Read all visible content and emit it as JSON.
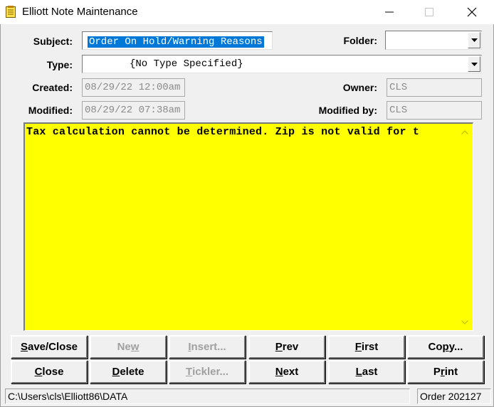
{
  "window": {
    "title": "Elliott Note Maintenance",
    "icon": "note-icon",
    "controls": [
      "minimize-icon",
      "maximize-icon",
      "close-icon"
    ]
  },
  "form": {
    "subject_label": "Subject:",
    "subject_value": "Order On Hold/Warning Reasons",
    "folder_label": "Folder:",
    "folder_value": "",
    "type_label": "Type:",
    "type_value": "{No Type Specified}",
    "created_label": "Created:",
    "created_value": "08/29/22 12:00am",
    "owner_label": "Owner:",
    "owner_value": "CLS",
    "modified_label": "Modified:",
    "modified_value": "08/29/22 07:38am",
    "modified_by_label": "Modified by:",
    "modified_by_value": "CLS"
  },
  "note": {
    "text": "Tax calculation cannot be determined. Zip is not valid for t",
    "background": "#ffff00"
  },
  "buttons": {
    "row1": [
      {
        "pre": "",
        "u": "S",
        "post": "ave/Close",
        "enabled": true
      },
      {
        "pre": "Ne",
        "u": "w",
        "post": "",
        "enabled": false
      },
      {
        "pre": "",
        "u": "I",
        "post": "nsert...",
        "enabled": false
      },
      {
        "pre": "",
        "u": "P",
        "post": "rev",
        "enabled": true
      },
      {
        "pre": "",
        "u": "F",
        "post": "irst",
        "enabled": true
      },
      {
        "pre": "Co",
        "u": "p",
        "post": "y...",
        "enabled": true
      }
    ],
    "row2": [
      {
        "pre": "",
        "u": "C",
        "post": "lose",
        "enabled": true
      },
      {
        "pre": "",
        "u": "D",
        "post": "elete",
        "enabled": true
      },
      {
        "pre": "",
        "u": "T",
        "post": "ickler...",
        "enabled": false
      },
      {
        "pre": "",
        "u": "N",
        "post": "ext",
        "enabled": true
      },
      {
        "pre": "",
        "u": "L",
        "post": "ast",
        "enabled": true
      },
      {
        "pre": "P",
        "u": "r",
        "post": "int",
        "enabled": true
      }
    ]
  },
  "status": {
    "path": "C:\\Users\\cls\\Elliott86\\DATA",
    "order": "Order 202127"
  }
}
